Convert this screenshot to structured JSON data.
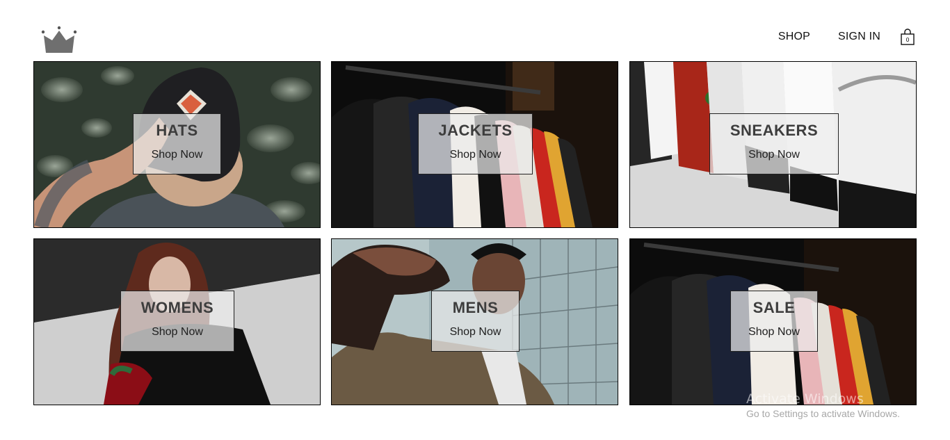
{
  "nav": {
    "shop": "SHOP",
    "sign_in": "SIGN IN",
    "bag_count": "0"
  },
  "tiles": [
    {
      "title": "HATS",
      "cta": "Shop Now"
    },
    {
      "title": "JACKETS",
      "cta": "Shop Now"
    },
    {
      "title": "SNEAKERS",
      "cta": "Shop Now"
    },
    {
      "title": "WOMENS",
      "cta": "Shop Now"
    },
    {
      "title": "MENS",
      "cta": "Shop Now"
    },
    {
      "title": "SALE",
      "cta": "Shop Now"
    }
  ],
  "watermark": {
    "title": "Activate Windows",
    "subtitle": "Go to Settings to activate Windows."
  },
  "colors": {
    "text": "#111111",
    "tile_label_bg": "#ebebeb",
    "border": "#000000"
  }
}
